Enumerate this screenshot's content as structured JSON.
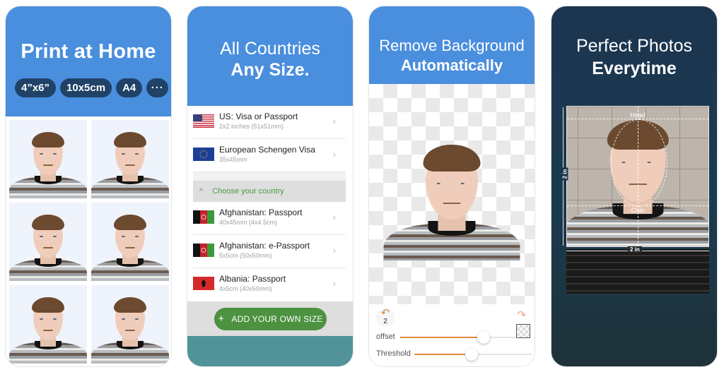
{
  "panels": [
    {
      "id": "print-at-home",
      "title": "Print at Home",
      "size_chips": [
        "4”x6”",
        "10x5cm",
        "A4",
        "···"
      ],
      "photo_grid_count": 6,
      "header_color": "#4a8ede",
      "chip_color": "#1f4266"
    },
    {
      "id": "all-countries",
      "title_line1": "All Countries",
      "title_line2": "Any Size.",
      "featured": [
        {
          "flag": "us-flag",
          "title": "US: Visa or Passport",
          "subtitle": "2x2 inches (51x51mm)"
        },
        {
          "flag": "eu-flag",
          "title": "European Schengen Visa",
          "subtitle": "35x45mm"
        }
      ],
      "choose_label": "Choose your country",
      "countries": [
        {
          "flag": "afghanistan-flag",
          "title": "Afghanistan: Passport",
          "subtitle": "40x45mm (4x4.5cm)"
        },
        {
          "flag": "afghanistan-flag",
          "title": "Afghanistan: e-Passport",
          "subtitle": "5x5cm (50x50mm)"
        },
        {
          "flag": "albania-flag",
          "title": "Albania: Passport",
          "subtitle": "4x5cm (40x50mm)"
        }
      ],
      "add_button": {
        "icon": "+",
        "label": "ADD YOUR OWN SIZE"
      },
      "accent_green": "#4c9240",
      "footer_color": "#519398"
    },
    {
      "id": "remove-background",
      "title_line1": "Remove Background",
      "title_line2": "Automatically",
      "undo_count": "2",
      "undo_icon": "↶",
      "redo_icon": "↷",
      "sliders": [
        {
          "label": "offset",
          "value": 0.73
        },
        {
          "label": "Threshold",
          "value": 0.49
        }
      ],
      "slider_color": "#e08a3c"
    },
    {
      "id": "perfect-photos",
      "title_line1": "Perfect Photos",
      "title_line2": "Everytime",
      "guide_top_label": "Head",
      "guide_bottom_label": "Chin",
      "dimension_vertical": "2 in",
      "dimension_horizontal": "2 in",
      "background_color": "#1c3550"
    }
  ]
}
